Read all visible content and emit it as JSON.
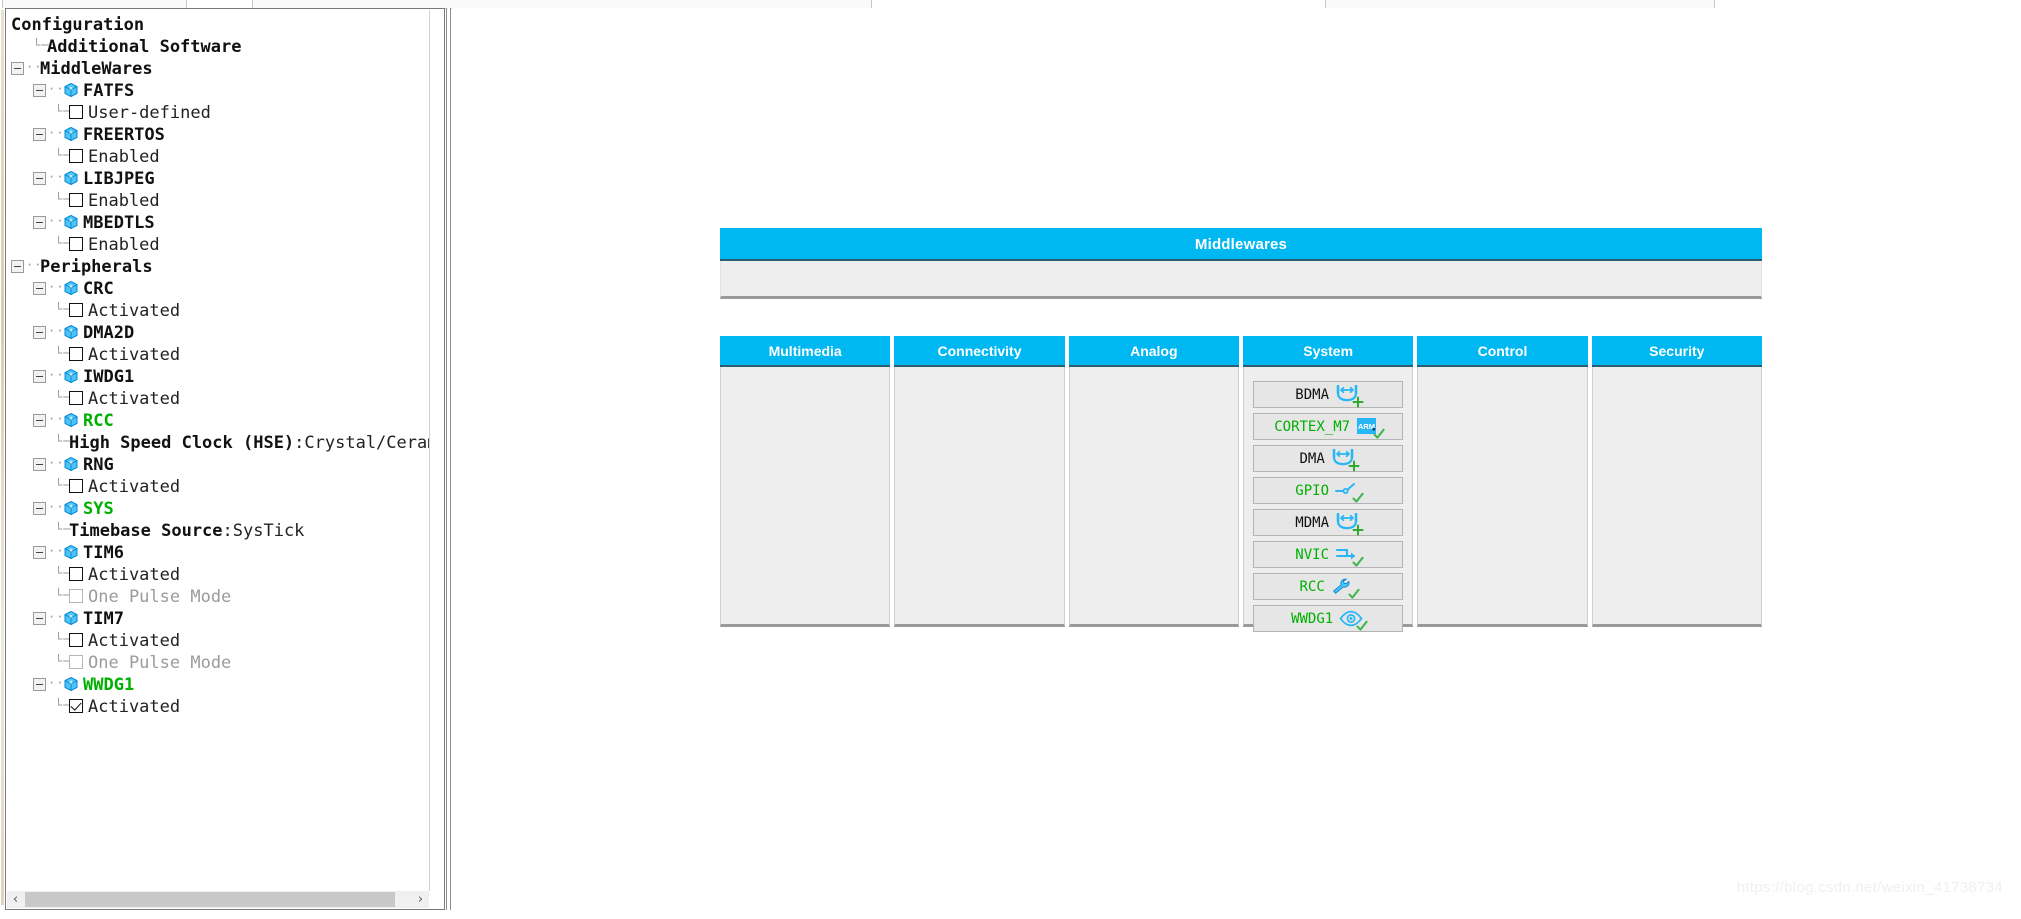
{
  "toolbar": {
    "fragments": 3
  },
  "tree": {
    "root_label": "Configuration",
    "nodes": [
      {
        "label": "Configuration",
        "depth": 0,
        "type": "root",
        "style": "bold"
      },
      {
        "label": "Additional Software",
        "depth": 1,
        "type": "leaf-plain",
        "style": "bold"
      },
      {
        "label": "MiddleWares",
        "depth": 0,
        "type": "group",
        "style": "bold",
        "expander": "minus"
      },
      {
        "label": "FATFS",
        "depth": 1,
        "type": "module",
        "style": "bold",
        "expander": "minus"
      },
      {
        "label": "User-defined",
        "depth": 2,
        "type": "check",
        "checked": false,
        "style": "normal"
      },
      {
        "label": "FREERTOS",
        "depth": 1,
        "type": "module",
        "style": "bold",
        "expander": "minus"
      },
      {
        "label": "Enabled",
        "depth": 2,
        "type": "check",
        "checked": false,
        "style": "normal"
      },
      {
        "label": "LIBJPEG",
        "depth": 1,
        "type": "module",
        "style": "bold",
        "expander": "minus"
      },
      {
        "label": "Enabled",
        "depth": 2,
        "type": "check",
        "checked": false,
        "style": "normal"
      },
      {
        "label": "MBEDTLS",
        "depth": 1,
        "type": "module",
        "style": "bold",
        "expander": "minus"
      },
      {
        "label": "Enabled",
        "depth": 2,
        "type": "check",
        "checked": false,
        "style": "normal"
      },
      {
        "label": "Peripherals",
        "depth": 0,
        "type": "group",
        "style": "bold",
        "expander": "minus"
      },
      {
        "label": "CRC",
        "depth": 1,
        "type": "module",
        "style": "bold",
        "expander": "minus"
      },
      {
        "label": "Activated",
        "depth": 2,
        "type": "check",
        "checked": false,
        "style": "normal"
      },
      {
        "label": "DMA2D",
        "depth": 1,
        "type": "module",
        "style": "bold",
        "expander": "minus"
      },
      {
        "label": "Activated",
        "depth": 2,
        "type": "check",
        "checked": false,
        "style": "normal"
      },
      {
        "label": "IWDG1",
        "depth": 1,
        "type": "module",
        "style": "bold",
        "expander": "minus"
      },
      {
        "label": "Activated",
        "depth": 2,
        "type": "check",
        "checked": false,
        "style": "normal"
      },
      {
        "label": "RCC",
        "depth": 1,
        "type": "module",
        "style": "green",
        "expander": "minus"
      },
      {
        "label": "High Speed Clock (HSE)",
        "value": ":Crystal/Ceramic Resona",
        "depth": 2,
        "type": "kv",
        "style": "bold"
      },
      {
        "label": "RNG",
        "depth": 1,
        "type": "module",
        "style": "bold",
        "expander": "minus"
      },
      {
        "label": "Activated",
        "depth": 2,
        "type": "check",
        "checked": false,
        "style": "normal"
      },
      {
        "label": "SYS",
        "depth": 1,
        "type": "module",
        "style": "green",
        "expander": "minus"
      },
      {
        "label": "Timebase Source",
        "value": ":SysTick",
        "depth": 2,
        "type": "kv",
        "style": "bold"
      },
      {
        "label": "TIM6",
        "depth": 1,
        "type": "module",
        "style": "bold",
        "expander": "minus"
      },
      {
        "label": "Activated",
        "depth": 2,
        "type": "check",
        "checked": false,
        "style": "normal"
      },
      {
        "label": "One Pulse Mode",
        "depth": 2,
        "type": "check",
        "checked": false,
        "disabled": true,
        "style": "grey"
      },
      {
        "label": "TIM7",
        "depth": 1,
        "type": "module",
        "style": "bold",
        "expander": "minus"
      },
      {
        "label": "Activated",
        "depth": 2,
        "type": "check",
        "checked": false,
        "style": "normal"
      },
      {
        "label": "One Pulse Mode",
        "depth": 2,
        "type": "check",
        "checked": false,
        "disabled": true,
        "style": "grey"
      },
      {
        "label": "WWDG1",
        "depth": 1,
        "type": "module",
        "style": "green",
        "expander": "minus"
      },
      {
        "label": "Activated",
        "depth": 2,
        "type": "check",
        "checked": true,
        "style": "normal"
      }
    ],
    "scrollbar": {
      "left_arrow": "‹",
      "right_arrow": "›"
    }
  },
  "middlewares_panel": {
    "title": "Middlewares"
  },
  "categories": [
    {
      "name": "Multimedia",
      "items": []
    },
    {
      "name": "Connectivity",
      "items": []
    },
    {
      "name": "Analog",
      "items": []
    },
    {
      "name": "System",
      "items": [
        {
          "label": "BDMA",
          "state": "add",
          "icon": "dma-icon",
          "green": false
        },
        {
          "label": "CORTEX_M7",
          "state": "activated",
          "icon": "arm-logo-icon",
          "green": true
        },
        {
          "label": "DMA",
          "state": "add",
          "icon": "dma-icon",
          "green": false
        },
        {
          "label": "GPIO",
          "state": "activated",
          "icon": "pin-icon",
          "green": true
        },
        {
          "label": "MDMA",
          "state": "add",
          "icon": "dma-icon",
          "green": false
        },
        {
          "label": "NVIC",
          "state": "activated",
          "icon": "interrupt-icon",
          "green": true
        },
        {
          "label": "RCC",
          "state": "activated",
          "icon": "wrench-icon",
          "green": true
        },
        {
          "label": "WWDG1",
          "state": "activated",
          "icon": "eye-icon",
          "green": true
        }
      ]
    },
    {
      "name": "Control",
      "items": []
    },
    {
      "name": "Security",
      "items": []
    }
  ],
  "colors": {
    "accent": "#00b8f1",
    "accent_underline": "#2a5d72",
    "panel_bg": "#eeeeee",
    "green": "#00b000",
    "button_bg": "#e6e6e6"
  },
  "watermark": {
    "text": "https://blog.csdn.net/weixin_41738734"
  }
}
